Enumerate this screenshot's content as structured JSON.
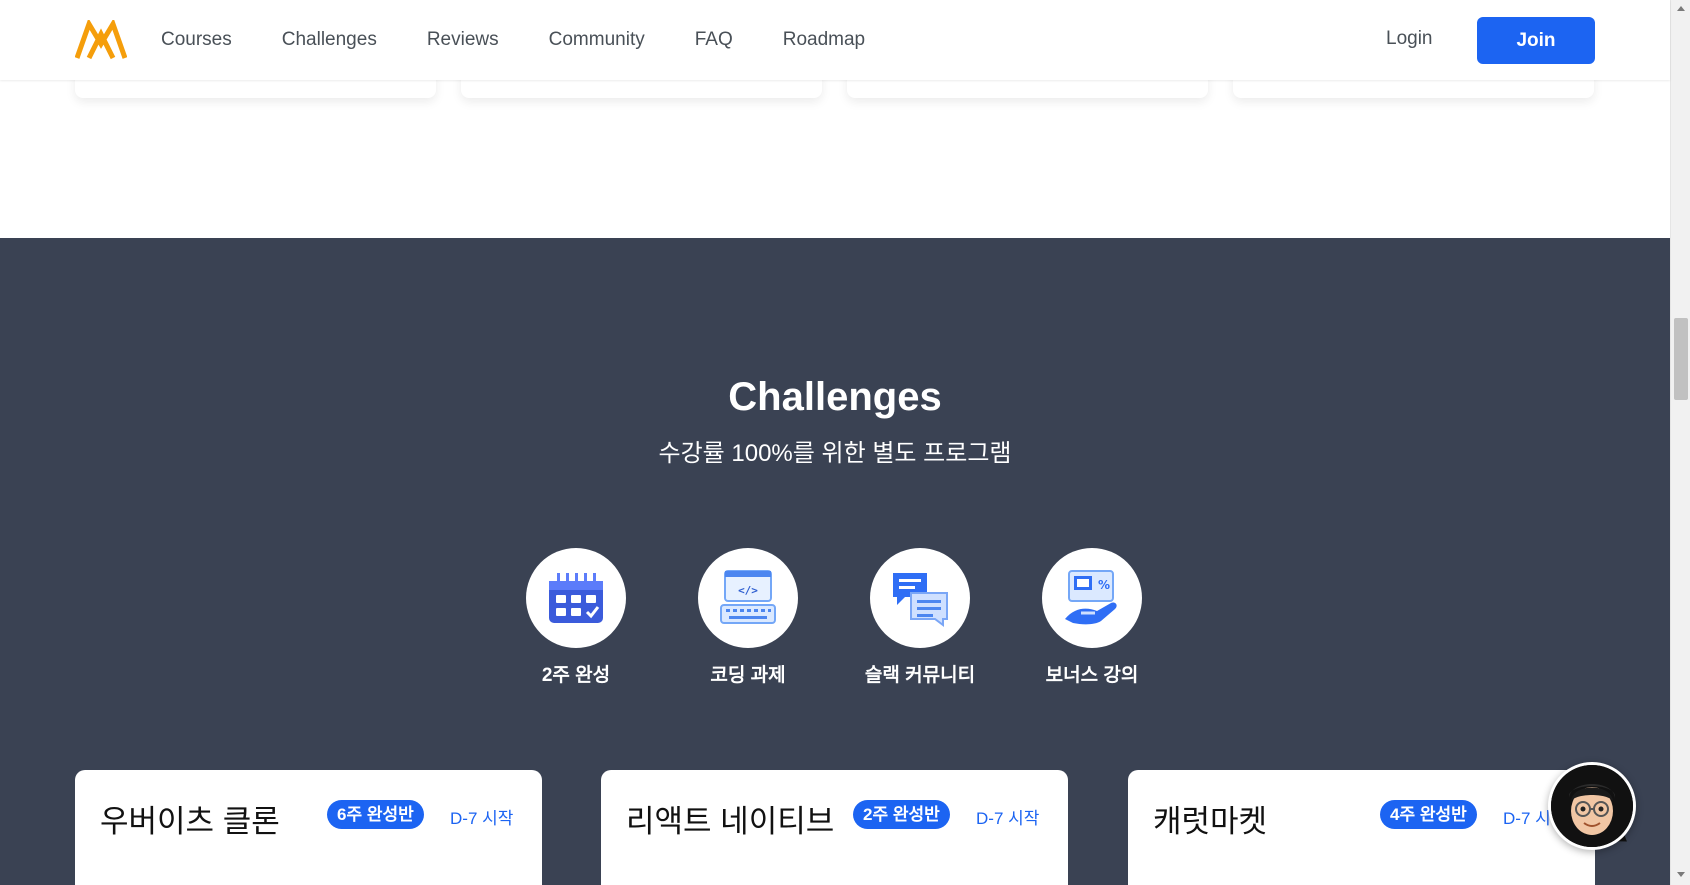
{
  "header": {
    "logo_icon": "mountain-logo-icon",
    "nav": [
      {
        "label": "Courses"
      },
      {
        "label": "Challenges"
      },
      {
        "label": "Reviews"
      },
      {
        "label": "Community"
      },
      {
        "label": "FAQ"
      },
      {
        "label": "Roadmap"
      }
    ],
    "login_label": "Login",
    "join_label": "Join"
  },
  "challenges": {
    "title": "Challenges",
    "subtitle": "수강률 100%를 위한 별도 프로그램",
    "features": [
      {
        "label": "2주 완성",
        "icon": "calendar-icon"
      },
      {
        "label": "코딩 과제",
        "icon": "code-keyboard-icon"
      },
      {
        "label": "슬랙 커뮤니티",
        "icon": "chat-bubbles-icon"
      },
      {
        "label": "보너스 강의",
        "icon": "bonus-hand-icon"
      }
    ],
    "courses": [
      {
        "title": "우버이츠 클론",
        "badge": "6주 완성반",
        "start": "D-7 시작"
      },
      {
        "title": "리액트 네이티브",
        "badge": "2주 완성반",
        "start": "D-7 시작"
      },
      {
        "title": "캐럿마켓",
        "badge": "4주 완성반",
        "start": "D-7 시작"
      }
    ]
  },
  "colors": {
    "accent": "#1c64f2",
    "dark_bg": "#3a4253",
    "logo": "#f59e0b"
  }
}
